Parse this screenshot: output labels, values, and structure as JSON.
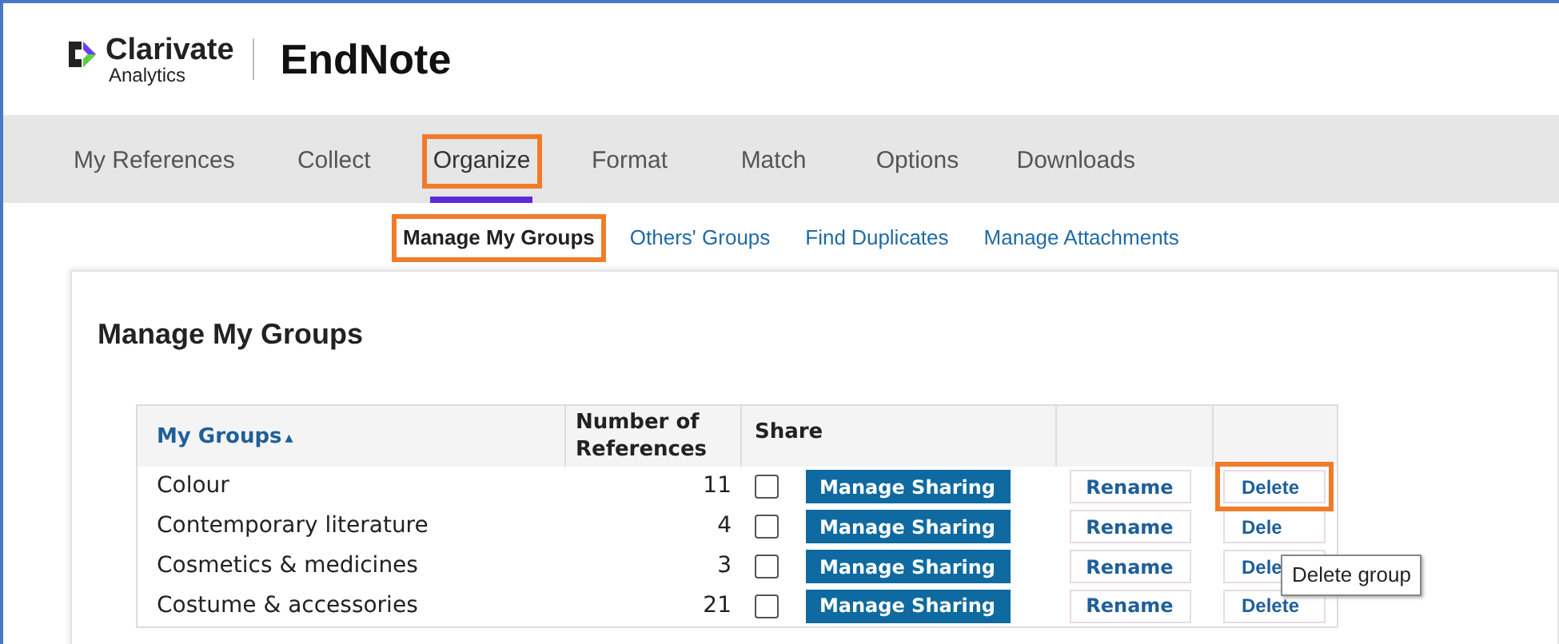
{
  "header": {
    "brand_top": "Clarivate",
    "brand_bottom": "Analytics",
    "product": "EndNote"
  },
  "nav": [
    {
      "label": "My References",
      "selected": false,
      "highlighted": false
    },
    {
      "label": "Collect",
      "selected": false,
      "highlighted": false
    },
    {
      "label": "Organize",
      "selected": true,
      "highlighted": true
    },
    {
      "label": "Format",
      "selected": false,
      "highlighted": false
    },
    {
      "label": "Match",
      "selected": false,
      "highlighted": false
    },
    {
      "label": "Options",
      "selected": false,
      "highlighted": false
    },
    {
      "label": "Downloads",
      "selected": false,
      "highlighted": false
    }
  ],
  "subnav": [
    {
      "label": "Manage My Groups",
      "selected": true,
      "highlighted": true
    },
    {
      "label": "Others' Groups",
      "selected": false,
      "highlighted": false
    },
    {
      "label": "Find Duplicates",
      "selected": false,
      "highlighted": false
    },
    {
      "label": "Manage Attachments",
      "selected": false,
      "highlighted": false
    }
  ],
  "page_title": "Manage My Groups",
  "table": {
    "columns": [
      "My Groups",
      "Number of References",
      "Share"
    ],
    "sort_icon": "▴",
    "rows": [
      {
        "name": "Colour",
        "count": "11",
        "shared": false,
        "sharing": "Manage Sharing",
        "rename": "Rename",
        "delete": "Delete",
        "delete_highlighted": true
      },
      {
        "name": "Contemporary literature",
        "count": "4",
        "shared": false,
        "sharing": "Manage Sharing",
        "rename": "Rename",
        "delete": "Dele",
        "delete_highlighted": false
      },
      {
        "name": "Cosmetics & medicines",
        "count": "3",
        "shared": false,
        "sharing": "Manage Sharing",
        "rename": "Rename",
        "delete": "Dele",
        "delete_highlighted": false
      },
      {
        "name": "Costume & accessories",
        "count": "21",
        "shared": false,
        "sharing": "Manage Sharing",
        "rename": "Rename",
        "delete": "Delete",
        "delete_highlighted": false
      }
    ]
  },
  "tooltip": "Delete group"
}
